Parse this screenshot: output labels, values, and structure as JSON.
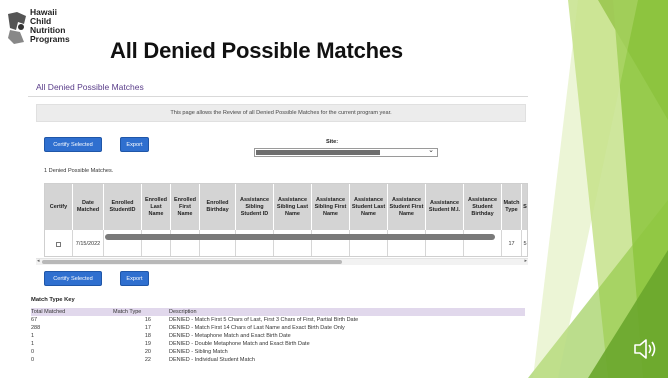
{
  "slide": {
    "title": "All Denied Possible Matches",
    "logo_lines": [
      "Hawaii",
      "Child",
      "Nutrition",
      "Programs"
    ]
  },
  "page": {
    "heading": "All Denied Possible Matches",
    "info": "This page allows the Review of all Denied Possible Matches for the current program year.",
    "certify_label": "Certify Selected",
    "export_label": "Export",
    "site_label": "Site:",
    "count_text": "1 Denied Possible Matches."
  },
  "table": {
    "columns": [
      "Certify",
      "Date Matched",
      "Enrolled StudentID",
      "Enrolled Last Name",
      "Enrolled First Name",
      "Enrolled Birthday",
      "Assistance Sibling Student ID",
      "Assistance Sibling Last Name",
      "Assistance Sibling First Name",
      "Assistance Student Last Name",
      "Assistance Student First Name",
      "Assistance Student M.I.",
      "Assistance Student Birthday",
      "Match Type",
      "S"
    ],
    "row": {
      "date": "7/15/2022",
      "match_type": "17",
      "trailing": "5"
    }
  },
  "match_key": {
    "title": "Match Type Key",
    "headers": [
      "Total Matched",
      "Match Type",
      "Description"
    ],
    "rows": [
      {
        "total": "67",
        "type": "16",
        "desc": "DENIED - Match First 5 Chars of Last, First 3 Chars of First, Partial Birth Date"
      },
      {
        "total": "288",
        "type": "17",
        "desc": "DENIED - Match First 14 Chars of Last Name and Exact Birth Date Only"
      },
      {
        "total": "1",
        "type": "18",
        "desc": "DENIED - Metaphone Match and Exact Birth Date"
      },
      {
        "total": "1",
        "type": "19",
        "desc": "DENIED - Double Metaphone Match and Exact Birth Date"
      },
      {
        "total": "0",
        "type": "20",
        "desc": "DENIED - Sibling Match"
      },
      {
        "total": "0",
        "type": "22",
        "desc": "DENIED - Individual Student Match"
      }
    ]
  },
  "colors": {
    "accent_green": "#8dc63f",
    "button_blue": "#2f6fcf",
    "heading_purple": "#5a3d8a"
  }
}
